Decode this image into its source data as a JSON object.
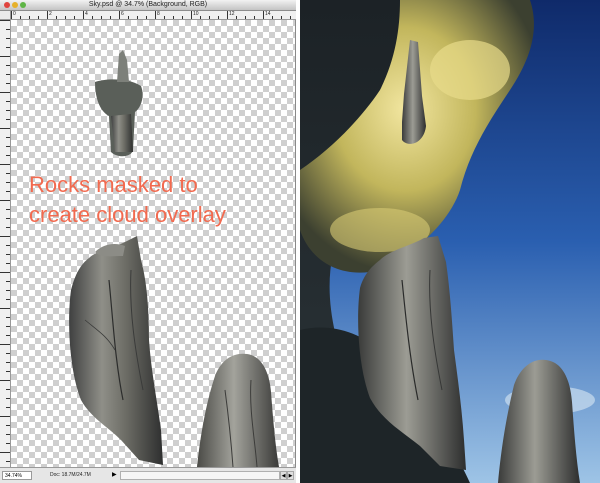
{
  "window": {
    "title": "Sky.psd @ 34.7% (Background, RGB)",
    "ruler_labels": [
      "0",
      "2",
      "4",
      "6",
      "8",
      "10",
      "12",
      "14"
    ]
  },
  "canvas": {
    "caption_line1": "Rocks masked to",
    "caption_line2": "create cloud overlay"
  },
  "status": {
    "zoom": "34.74%",
    "doc_size": "Doc: 18.7M/24.7M"
  },
  "colors": {
    "caption": "#f26a4f",
    "sky_top": "#1b3e8c",
    "cloud_yellow": "#e6d77a"
  },
  "icons": {
    "status_arrow": "triangle-right-icon"
  }
}
